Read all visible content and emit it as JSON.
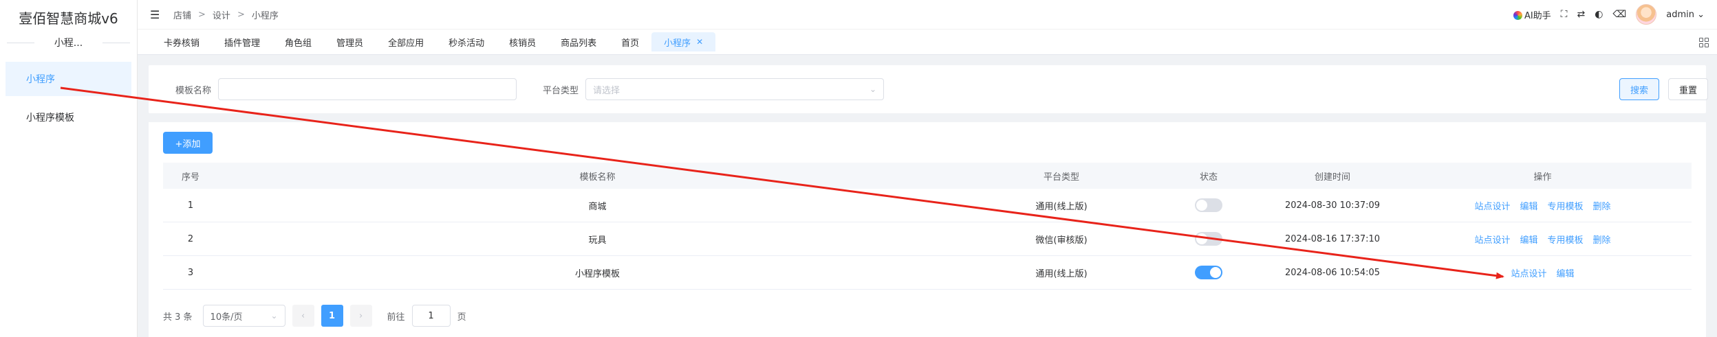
{
  "app": {
    "brand": "壹佰智慧商城v6",
    "section": "小程..."
  },
  "sidebar": {
    "items": [
      {
        "label": "小程序",
        "active": true
      },
      {
        "label": "小程序模板",
        "active": false
      }
    ]
  },
  "breadcrumb": [
    "店铺",
    "设计",
    "小程序"
  ],
  "topbar": {
    "ai_label": "AI助手",
    "user": "admin"
  },
  "tabs": [
    {
      "label": "卡券核销"
    },
    {
      "label": "插件管理"
    },
    {
      "label": "角色组"
    },
    {
      "label": "管理员"
    },
    {
      "label": "全部应用"
    },
    {
      "label": "秒杀活动"
    },
    {
      "label": "核销员"
    },
    {
      "label": "商品列表"
    },
    {
      "label": "首页"
    },
    {
      "label": "小程序",
      "active": true
    }
  ],
  "search": {
    "template_name_label": "模板名称",
    "template_name_value": "",
    "platform_label": "平台类型",
    "platform_placeholder": "请选择",
    "search_btn": "搜索",
    "reset_btn": "重置"
  },
  "add_btn": "+添加",
  "table": {
    "headers": [
      "序号",
      "模板名称",
      "平台类型",
      "状态",
      "创建时间",
      "操作"
    ],
    "rows": [
      {
        "idx": "1",
        "name": "商城",
        "platform": "通用(线上版)",
        "status": false,
        "time": "2024-08-30 10:37:09",
        "ops": [
          "站点设计",
          "编辑",
          "专用模板",
          "删除"
        ]
      },
      {
        "idx": "2",
        "name": "玩具",
        "platform": "微信(审核版)",
        "status": false,
        "time": "2024-08-16 17:37:10",
        "ops": [
          "站点设计",
          "编辑",
          "专用模板",
          "删除"
        ]
      },
      {
        "idx": "3",
        "name": "小程序模板",
        "platform": "通用(线上版)",
        "status": true,
        "time": "2024-08-06 10:54:05",
        "ops": [
          "站点设计",
          "编辑"
        ]
      }
    ]
  },
  "pagination": {
    "total": "共 3 条",
    "page_size": "10条/页",
    "current": "1",
    "goto_label": "前往",
    "goto_value": "1",
    "page_unit": "页"
  },
  "colors": {
    "accent": "#409eff",
    "annotation": "#e8231a"
  }
}
